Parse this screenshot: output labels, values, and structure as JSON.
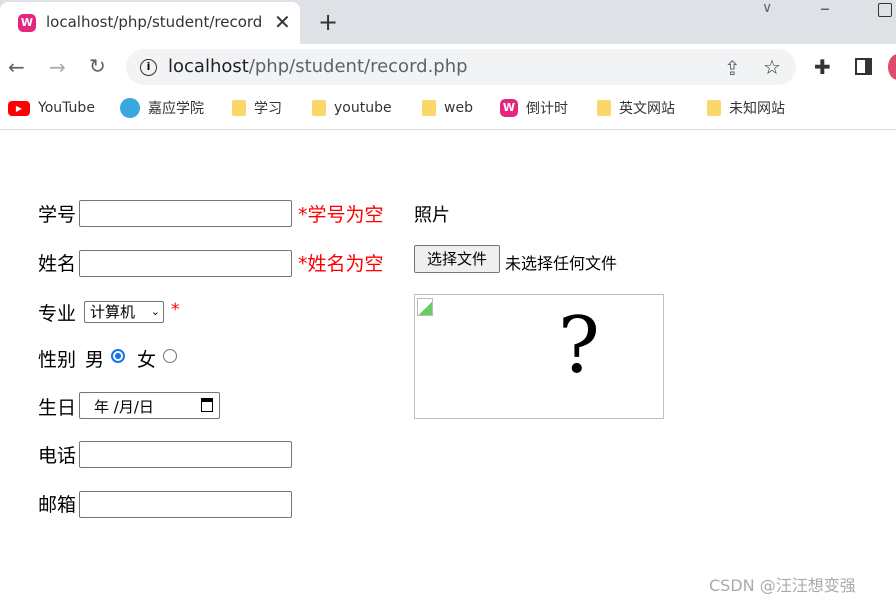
{
  "browser": {
    "tab_title": "localhost/php/student/record.php",
    "url_host": "localhost",
    "url_path": "/php/student/record.php",
    "bookmarks": [
      {
        "label": "YouTube",
        "icon": "youtube-icon"
      },
      {
        "label": "嘉应学院",
        "icon": "site-icon"
      },
      {
        "label": "学习",
        "icon": "folder-icon"
      },
      {
        "label": "youtube",
        "icon": "folder-icon"
      },
      {
        "label": "web",
        "icon": "folder-icon"
      },
      {
        "label": "倒计时",
        "icon": "wamp-icon"
      },
      {
        "label": "英文网站",
        "icon": "folder-icon"
      },
      {
        "label": "未知网站",
        "icon": "folder-icon"
      }
    ]
  },
  "form": {
    "id_label": "学号",
    "id_error": "*学号为空",
    "name_label": "姓名",
    "name_error": "*姓名为空",
    "major_label": "专业",
    "major_value": "计算机",
    "major_required": "*",
    "gender_label": "性别",
    "male": "男",
    "female": "女",
    "gender_selected": "男",
    "birthday_label": "生日",
    "birthday_placeholder": "年 /月/日",
    "phone_label": "电话",
    "email_label": "邮箱",
    "photo_label": "照片",
    "file_button": "选择文件",
    "file_status": "未选择任何文件"
  },
  "watermark": "CSDN @汪汪想变强"
}
